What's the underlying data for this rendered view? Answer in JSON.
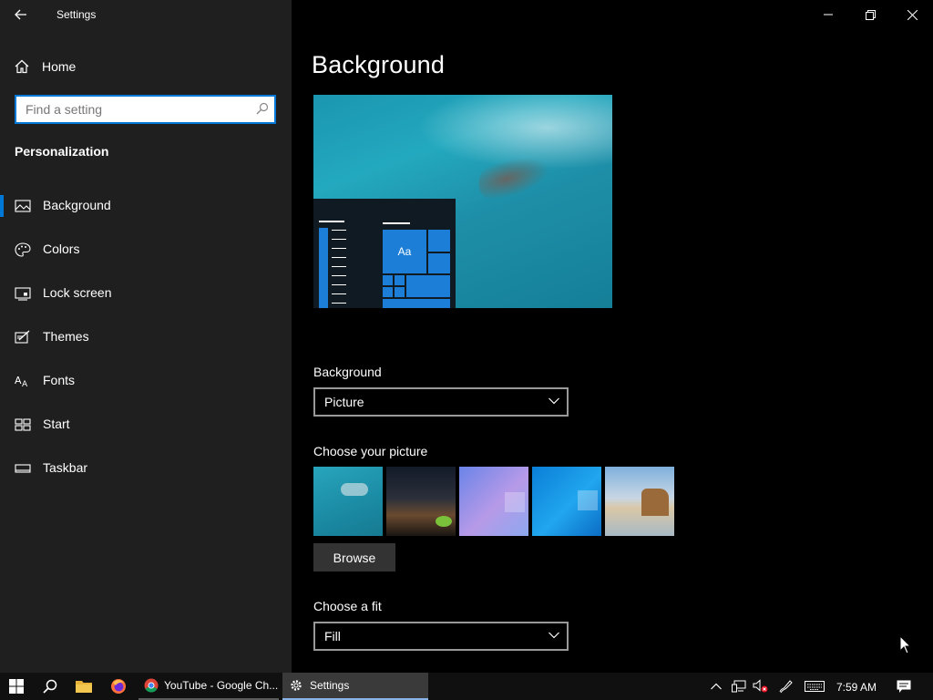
{
  "window": {
    "title": "Settings"
  },
  "sidebar": {
    "home_label": "Home",
    "search_placeholder": "Find a setting",
    "section_title": "Personalization",
    "items": [
      {
        "label": "Background",
        "icon": "picture-icon",
        "active": true
      },
      {
        "label": "Colors",
        "icon": "palette-icon"
      },
      {
        "label": "Lock screen",
        "icon": "lock-screen-icon"
      },
      {
        "label": "Themes",
        "icon": "themes-icon"
      },
      {
        "label": "Fonts",
        "icon": "fonts-icon"
      },
      {
        "label": "Start",
        "icon": "start-icon"
      },
      {
        "label": "Taskbar",
        "icon": "taskbar-icon"
      }
    ]
  },
  "main": {
    "page_title": "Background",
    "preview_tile_text": "Aa",
    "background_label": "Background",
    "background_value": "Picture",
    "choose_picture_label": "Choose your picture",
    "browse_label": "Browse",
    "choose_fit_label": "Choose a fit",
    "fit_value": "Fill"
  },
  "taskbar": {
    "apps": [
      {
        "label": "YouTube - Google Ch...",
        "icon": "chrome-icon"
      },
      {
        "label": "Settings",
        "icon": "gear-icon",
        "active": true
      }
    ],
    "clock": "7:59 AM"
  },
  "colors": {
    "accent": "#0078d7",
    "sidebar_bg": "#1f1f1f",
    "main_bg": "#000000"
  }
}
